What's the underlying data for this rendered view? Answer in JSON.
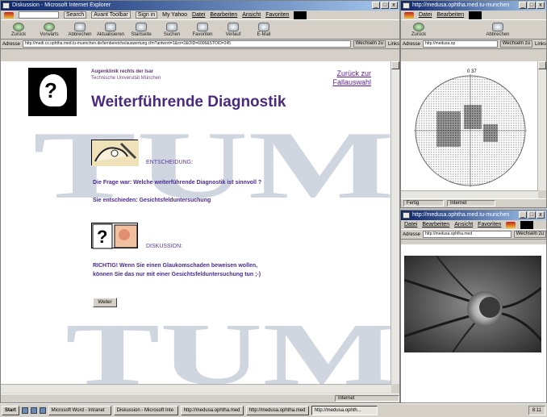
{
  "main_window": {
    "title": "Diskussion - Microsoft Internet Explorer",
    "toolbar_top": {
      "search_field": "",
      "search_button": "Search",
      "items": [
        "Avant Toolbar",
        "Sign in",
        "My Yahoo",
        "Datei",
        "Bearbeiten",
        "Ansicht",
        "Favoriten"
      ]
    },
    "nav_buttons": [
      "Zurück",
      "Vorwärts",
      "Abbrechen",
      "Aktualisieren",
      "Startseite",
      "Suchen",
      "Favoriten",
      "Verlauf",
      "E-Mail"
    ],
    "address_label": "Adresse",
    "url": "http://medi.cs.ophtha.med.tu-muenchen.de/lernbereiche/auswertung.cfm?antwort=1&nr=2&OID=6006&STOID=245",
    "go_label": "Wechseln zu",
    "links_label": "Links",
    "status": {
      "left": "",
      "zone": "Internet"
    }
  },
  "page": {
    "institute_line1": "Augenklinik rechts der Isar",
    "institute_line2": "Technische Universität München",
    "back_link": "Zurück zur Fallauswahl",
    "title": "Weiterführende Diagnostik",
    "section1_label": "ENTSCHEIDUNG:",
    "question": "Die Frage war: Welche weiterführende Diagnostik ist sinnvoll ?",
    "answer": "Sie entschieden: Gesichtsfelduntersuchung",
    "section2_label": "DISKUSSION:",
    "discussion_line1": "RICHTIG! Wenn Sie einen Glaukomschaden beweisen wollen,",
    "discussion_line2": "können Sie das nur mit einer Gesichtsfelduntersuchung tun ;-)",
    "next_button": "Weiter",
    "watermark": "TUM"
  },
  "right_top_window": {
    "title": "http://medusa.ophtha.med.tu-munchen",
    "menu": [
      "Datei",
      "Bearbeiten"
    ],
    "address_label": "Adresse",
    "url": "http://medusa.op",
    "go_label": "Wechseln zu",
    "links_label": "Links",
    "nav_buttons": [
      "Zurück",
      "Abbrechen"
    ],
    "status_left": "Fertig",
    "status_zone": "Internet",
    "field_label": "0 37"
  },
  "right_bottom_window": {
    "title": "http://medusa.ophtha.med.tu-munchen",
    "menu": [
      "Datei",
      "Bearbeiten",
      "Ansicht",
      "Favoriten"
    ],
    "address_label": "Adresse",
    "url": "http://medusa.ophtha.med",
    "go_label": "Wechseln zu"
  },
  "taskbar": {
    "start": "Start",
    "tasks": [
      "Microsoft Word - Intranet",
      "Diskussion - Microsoft Inte",
      "http://medusa.ophtha.med",
      "http://medusa.ophtha.med",
      "http://medusa.ophth..."
    ],
    "clock": "8:11"
  },
  "colors": {
    "title_purple": "#4a2a7a",
    "link_purple": "#5a1a9a",
    "titlebar_blue": "#0a246a"
  }
}
